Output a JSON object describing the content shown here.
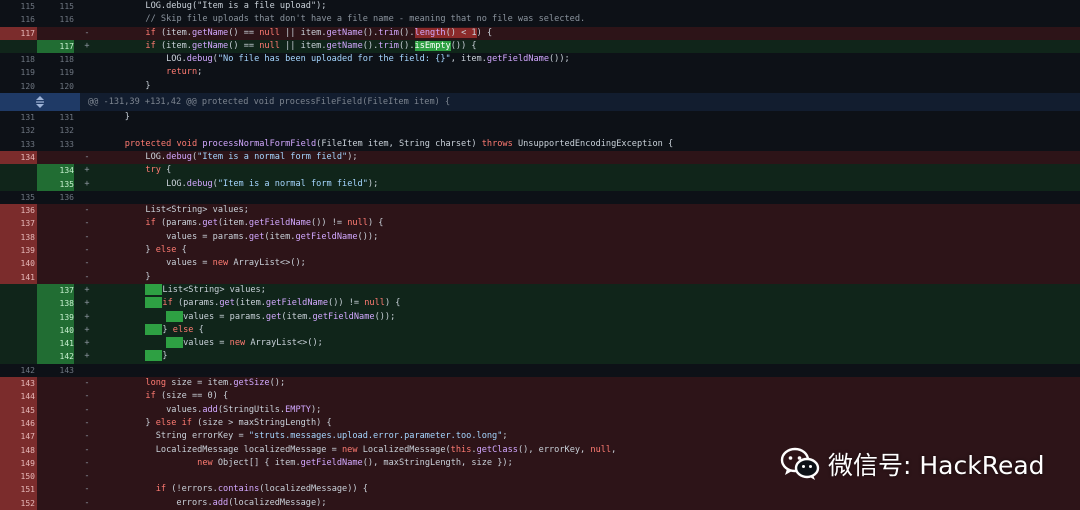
{
  "rows": [
    {
      "type": "ctx",
      "o": "115",
      "n": "115",
      "m": "",
      "h": "        LOG.debug(\"Item is a file upload\");"
    },
    {
      "type": "ctx",
      "o": "116",
      "n": "116",
      "m": "",
      "h": "        <span class=\"cm\">// Skip file uploads that don't have a file name - meaning that no file was selected.</span>"
    },
    {
      "type": "del",
      "o": "117",
      "n": "",
      "m": "-",
      "h": "        <span class=\"kw\">if</span> (item.<span class=\"fn\">getName</span>() == <span class=\"kw\">null</span> || item.<span class=\"fn\">getName</span>().<span class=\"fn\">trim</span>().<span class=\"hl-del\"><span class=\"fn\">length</span>() &lt; 1</span>) {"
    },
    {
      "type": "add",
      "o": "",
      "n": "117",
      "m": "+",
      "h": "        <span class=\"kw\">if</span> (item.<span class=\"fn\">getName</span>() == <span class=\"kw\">null</span> || item.<span class=\"fn\">getName</span>().<span class=\"fn\">trim</span>().<span class=\"hl-add\">isEmpty</span>()) {"
    },
    {
      "type": "ctx",
      "o": "118",
      "n": "118",
      "m": "",
      "h": "            LOG.<span class=\"fn\">debug</span>(<span class=\"str\">\"No file has been uploaded for the field: {}\"</span>, item.<span class=\"fn\">getFieldName</span>());"
    },
    {
      "type": "ctx",
      "o": "119",
      "n": "119",
      "m": "",
      "h": "            <span class=\"kw\">return</span>;"
    },
    {
      "type": "ctx",
      "o": "120",
      "n": "120",
      "m": "",
      "h": "        }"
    },
    {
      "type": "hunk",
      "o": "",
      "n": "",
      "m": "",
      "h": "@@ -131,39 +131,42 @@ protected void processFileField(FileItem item) {"
    },
    {
      "type": "ctx",
      "o": "131",
      "n": "131",
      "m": "",
      "h": "    }"
    },
    {
      "type": "ctx",
      "o": "132",
      "n": "132",
      "m": "",
      "h": ""
    },
    {
      "type": "ctx",
      "o": "133",
      "n": "133",
      "m": "",
      "h": "    <span class=\"kw\">protected void</span> <span class=\"fn\">processNormalFormField</span>(FileItem item, String charset) <span class=\"kw\">throws</span> UnsupportedEncodingException {"
    },
    {
      "type": "del",
      "o": "134",
      "n": "",
      "m": "-",
      "h": "        LOG.<span class=\"fn\">debug</span>(<span class=\"str\">\"Item is a normal form field\"</span>);"
    },
    {
      "type": "add",
      "o": "",
      "n": "134",
      "m": "+",
      "h": "        <span class=\"kw\">try</span> {"
    },
    {
      "type": "add",
      "o": "",
      "n": "135",
      "m": "+",
      "h": "            LOG.<span class=\"fn\">debug</span>(<span class=\"str\">\"Item is a normal form field\"</span>);"
    },
    {
      "type": "ctx",
      "o": "135",
      "n": "136",
      "m": "",
      "h": ""
    },
    {
      "type": "del",
      "o": "136",
      "n": "",
      "m": "-",
      "h": "        List&lt;String&gt; values;"
    },
    {
      "type": "del",
      "o": "137",
      "n": "",
      "m": "-",
      "h": "        <span class=\"kw\">if</span> (params.<span class=\"fn\">get</span>(item.<span class=\"fn\">getFieldName</span>()) != <span class=\"kw\">null</span>) {"
    },
    {
      "type": "del",
      "o": "138",
      "n": "",
      "m": "-",
      "h": "            values = params.<span class=\"fn\">get</span>(item.<span class=\"fn\">getFieldName</span>());"
    },
    {
      "type": "del",
      "o": "139",
      "n": "",
      "m": "-",
      "h": "        } <span class=\"kw\">else</span> {"
    },
    {
      "type": "del",
      "o": "140",
      "n": "",
      "m": "-",
      "h": "            values = <span class=\"kw\">new</span> ArrayList&lt;&gt;();"
    },
    {
      "type": "del",
      "o": "141",
      "n": "",
      "m": "-",
      "h": "        }"
    },
    {
      "type": "add",
      "o": "",
      "n": "137",
      "m": "+",
      "h": "        <span class=\"ws\" style=\"width:17px\"></span>List&lt;String&gt; values;"
    },
    {
      "type": "add",
      "o": "",
      "n": "138",
      "m": "+",
      "h": "        <span class=\"ws\" style=\"width:17px\"></span><span class=\"kw\">if</span> (params.<span class=\"fn\">get</span>(item.<span class=\"fn\">getFieldName</span>()) != <span class=\"kw\">null</span>) {"
    },
    {
      "type": "add",
      "o": "",
      "n": "139",
      "m": "+",
      "h": "            <span class=\"ws\" style=\"width:17px\"></span>values = params.<span class=\"fn\">get</span>(item.<span class=\"fn\">getFieldName</span>());"
    },
    {
      "type": "add",
      "o": "",
      "n": "140",
      "m": "+",
      "h": "        <span class=\"ws\" style=\"width:17px\"></span>} <span class=\"kw\">else</span> {"
    },
    {
      "type": "add",
      "o": "",
      "n": "141",
      "m": "+",
      "h": "            <span class=\"ws\" style=\"width:17px\"></span>values = <span class=\"kw\">new</span> ArrayList&lt;&gt;();"
    },
    {
      "type": "add",
      "o": "",
      "n": "142",
      "m": "+",
      "h": "        <span class=\"ws\" style=\"width:17px\"></span>}"
    },
    {
      "type": "ctx",
      "o": "142",
      "n": "143",
      "m": "",
      "h": ""
    },
    {
      "type": "del",
      "o": "143",
      "n": "",
      "m": "-",
      "h": "        <span class=\"kw\">long</span> size = item.<span class=\"fn\">getSize</span>();"
    },
    {
      "type": "del",
      "o": "144",
      "n": "",
      "m": "-",
      "h": "        <span class=\"kw\">if</span> (size == 0) {"
    },
    {
      "type": "del",
      "o": "145",
      "n": "",
      "m": "-",
      "h": "            values.<span class=\"fn\">add</span>(StringUtils.<span class=\"fn\">EMPTY</span>);"
    },
    {
      "type": "del",
      "o": "146",
      "n": "",
      "m": "-",
      "h": "        } <span class=\"kw\">else if</span> (size &gt; maxStringLength) {"
    },
    {
      "type": "del",
      "o": "147",
      "n": "",
      "m": "-",
      "h": "          String errorKey = <span class=\"str\">\"struts.messages.upload.error.parameter.too.long\"</span>;"
    },
    {
      "type": "del",
      "o": "148",
      "n": "",
      "m": "-",
      "h": "          LocalizedMessage localizedMessage = <span class=\"kw\">new</span> LocalizedMessage(<span class=\"kw\">this</span>.<span class=\"fn\">getClass</span>(), errorKey, <span class=\"kw\">null</span>,"
    },
    {
      "type": "del",
      "o": "149",
      "n": "",
      "m": "-",
      "h": "                  <span class=\"kw\">new</span> Object[] { item.<span class=\"fn\">getFieldName</span>(), maxStringLength, size });"
    },
    {
      "type": "del",
      "o": "150",
      "n": "",
      "m": "-",
      "h": ""
    },
    {
      "type": "del",
      "o": "151",
      "n": "",
      "m": "-",
      "h": "          <span class=\"kw\">if</span> (!errors.<span class=\"fn\">contains</span>(localizedMessage)) {"
    },
    {
      "type": "del",
      "o": "152",
      "n": "",
      "m": "-",
      "h": "              errors.<span class=\"fn\">add</span>(localizedMessage);"
    }
  ],
  "watermark": {
    "text": "微信号: HackRead",
    "icon": "wechat-icon"
  },
  "colors": {
    "background": "#0d1117",
    "deleted_line": "#2d1418",
    "added_line": "#10251a",
    "deleted_gutter": "#7b2c2c",
    "added_gutter": "#216d33",
    "hunk_header": "#121d2f"
  }
}
